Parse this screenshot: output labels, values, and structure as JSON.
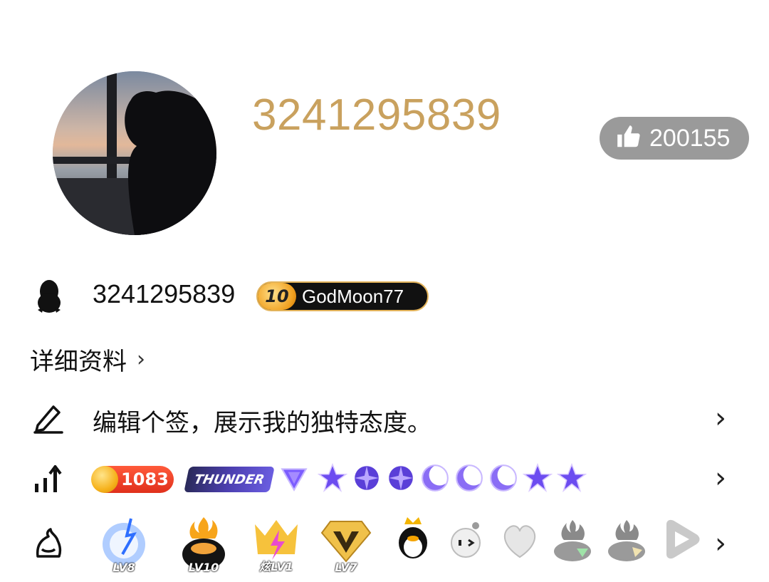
{
  "profile": {
    "uin_title": "3241295839",
    "like_count": "200155",
    "qq_number": "3241295839",
    "level_badge": {
      "level": "10",
      "nickname": "GodMoon77"
    },
    "detail_link": "详细资料",
    "signature": "编辑个签，展示我的独特态度。"
  },
  "badges_row": {
    "coin_count": "1083",
    "thunder_label": "THUNDER",
    "gems": [
      "triangle-gem-icon",
      "star-gem-icon",
      "sparkle-gem-icon",
      "sparkle-gem-icon",
      "moon-gem-icon",
      "moon-gem-icon",
      "moon-gem-icon",
      "star-gem-icon",
      "star-gem-icon"
    ]
  },
  "shelf_row": {
    "items": [
      {
        "icon": "lv8-badge-icon",
        "label": "LV8"
      },
      {
        "icon": "lv10-badge-icon",
        "label": "LV10"
      },
      {
        "icon": "lightning-badge-icon",
        "label": "炫LV1"
      },
      {
        "icon": "gold-v-badge-icon",
        "label": "LV7"
      },
      {
        "icon": "crowned-penguin-icon",
        "label": ""
      },
      {
        "icon": "round-face-icon",
        "label": ""
      },
      {
        "icon": "heart-icon",
        "label": ""
      },
      {
        "icon": "gray-flame-badge-icon",
        "label": ""
      },
      {
        "icon": "gray-flame-badge-icon",
        "label": ""
      },
      {
        "icon": "play-icon",
        "label": ""
      }
    ]
  },
  "colors": {
    "accent_gold": "#c9a15e",
    "like_pill_bg": "#9a9a9a"
  }
}
